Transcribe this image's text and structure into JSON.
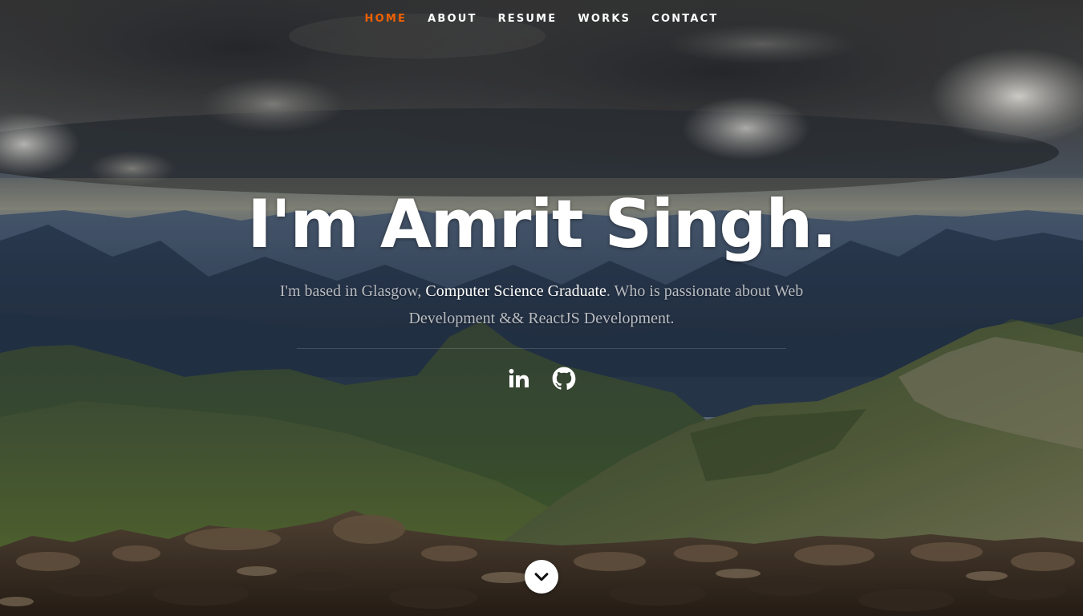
{
  "nav": {
    "items": [
      {
        "label": "Home",
        "active": true
      },
      {
        "label": "About",
        "active": false
      },
      {
        "label": "Resume",
        "active": false
      },
      {
        "label": "Works",
        "active": false
      },
      {
        "label": "Contact",
        "active": false
      }
    ],
    "active_color": "#f06000"
  },
  "banner": {
    "headline": "I'm Amrit Singh.",
    "intro_prefix": "I'm based in Glasgow, ",
    "intro_highlight": "Computer Science Graduate",
    "intro_suffix": ". Who is passionate about Web Development && ReactJS Development."
  },
  "social": [
    {
      "icon": "linkedin-icon"
    },
    {
      "icon": "github-icon"
    }
  ],
  "scroll": {
    "icon": "chevron-down-icon"
  }
}
